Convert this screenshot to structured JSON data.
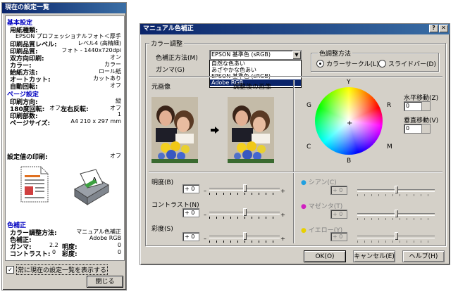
{
  "left": {
    "title": "現在の設定一覧",
    "basic_header": "基本設定",
    "paper_label": "用紙種類:",
    "paper_value": "EPSON プロフェッショナルフォト＜厚手 光沢...",
    "quality_level_label": "印刷品質レベル:",
    "quality_level_value": "レベル4 (高精細)",
    "quality_label": "印刷品質:",
    "quality_value": "フォト - 1440x720dpi",
    "bidir_label": "双方向印刷:",
    "bidir_value": "オン",
    "color_label": "カラー:",
    "color_value": "カラー",
    "source_label": "給紙方法:",
    "source_value": "ロール紙",
    "autocut_label": "オートカット:",
    "autocut_value": "カットあり",
    "autorotate_label": "自動回転:",
    "autorotate_value": "オフ",
    "page_header": "ページ設定",
    "orientation_label": "印刷方向:",
    "orientation_value": "縦",
    "rotate180_label": "180度回転:",
    "rotate180_value": "オフ",
    "mirror_label": "左右反転:",
    "mirror_value": "オフ",
    "copies_label": "印刷部数:",
    "copies_value": "1",
    "pagesize_label": "ページサイズ:",
    "pagesize_value": "A4 210 x 297 mm",
    "print_settings_label": "設定値の印刷:",
    "print_settings_value": "オフ",
    "color_adj_header": "色補正",
    "adj_method_label": "カラー調整方法:",
    "adj_method_value": "マニュアル色補正",
    "color_mode_label": "色補正:",
    "color_mode_value": "Adobe RGB",
    "gamma_label": "ガンマ:",
    "gamma_value": "2.2",
    "brightness_label": "明度:",
    "brightness_value": "0",
    "contrast_label": "コントラスト:",
    "contrast_value": "0",
    "saturation_label": "彩度:",
    "saturation_value": "0",
    "always_show_label": "常に現在の設定一覧を表示する",
    "always_show_checked": true,
    "close_button": "閉じる"
  },
  "right": {
    "title": "マニュアル色補正",
    "color_adjust_group": "カラー調整",
    "mode_label": "色補正方法(M)",
    "mode_selected": "EPSON 基準色 (sRGB)",
    "gamma_label": "ガンマ(G)",
    "dropdown_options": [
      "自然な色あい",
      "あざやかな色あい",
      "EPSON 基準色 (sRGB)",
      "Adobe RGB"
    ],
    "dropdown_highlighted_index": 3,
    "method_group": "色調整方法",
    "radio_colorcircle": "カラーサークル(L)",
    "radio_slidebar": "スライドバー(D)",
    "radio_selected": "colorcircle",
    "original_label": "元画像",
    "after_label": "調整後の画像",
    "wheel_labels": {
      "top": "Y",
      "bottom": "B",
      "left": "C",
      "right": "M",
      "topleft": "G",
      "topright": "R"
    },
    "horizontal_label": "水平移動(Z)",
    "horizontal_value": "0",
    "vertical_label": "垂直移動(V)",
    "vertical_value": "0",
    "brightness_label": "明度(B)",
    "brightness_value": "+ 0",
    "contrast_label": "コントラスト(N)",
    "contrast_value": "+ 0",
    "saturation_label": "彩度(S)",
    "saturation_value": "+ 0",
    "cyan_label": "シアン(C)",
    "cyan_value": "+ 0",
    "magenta_label": "マゼンタ(T)",
    "magenta_value": "+ 0",
    "yellow_label": "イエロー(Y)",
    "yellow_value": "+ 0",
    "ok_button": "OK(O)",
    "cancel_button": "キャンセル(E)",
    "help_button": "ヘルプ(H)",
    "slider_levels": {
      "brightness": 0.5,
      "contrast": 0.5,
      "saturation": 0.5,
      "cyan": 0.5,
      "magenta": 0.5,
      "yellow": 0.5
    }
  }
}
